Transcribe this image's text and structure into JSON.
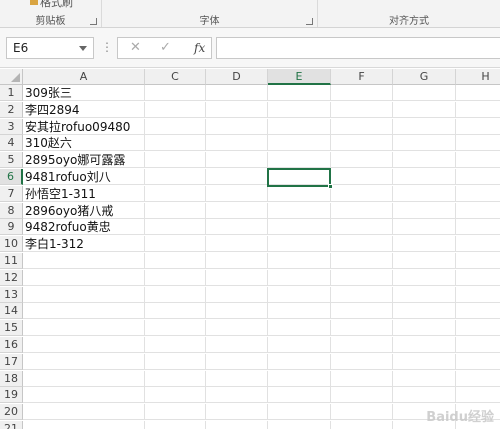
{
  "ribbon": {
    "clipped_text": "格式刷",
    "groups": [
      {
        "label": "剪贴板"
      },
      {
        "label": "字体"
      },
      {
        "label": "对齐方式"
      }
    ]
  },
  "formula_bar": {
    "name_box": "E6",
    "cancel_glyph": "✕",
    "enter_glyph": "✓",
    "fx_label": "fx",
    "formula": ""
  },
  "sheet": {
    "columns": [
      "A",
      "C",
      "D",
      "E",
      "F",
      "G",
      "H"
    ],
    "rows": [
      "1",
      "2",
      "3",
      "4",
      "5",
      "6",
      "7",
      "8",
      "9",
      "10",
      "11",
      "12",
      "13",
      "14",
      "15",
      "16",
      "17",
      "18",
      "19",
      "20",
      "21"
    ],
    "selected_cell": "E6",
    "column_a": [
      "309张三",
      "李四2894",
      "安其拉rofuo09480",
      "310赵六",
      "2895oyo娜可露露",
      "9481rofuo刘八",
      "孙悟空1-311",
      "2896oyo猪八戒",
      "9482rofuo黄忠",
      "李白1-312"
    ]
  },
  "watermark": "Baidu经验",
  "colors": {
    "accent": "#217346",
    "gridline": "#e1e1e1",
    "header_bg": "#f0f0f0"
  }
}
